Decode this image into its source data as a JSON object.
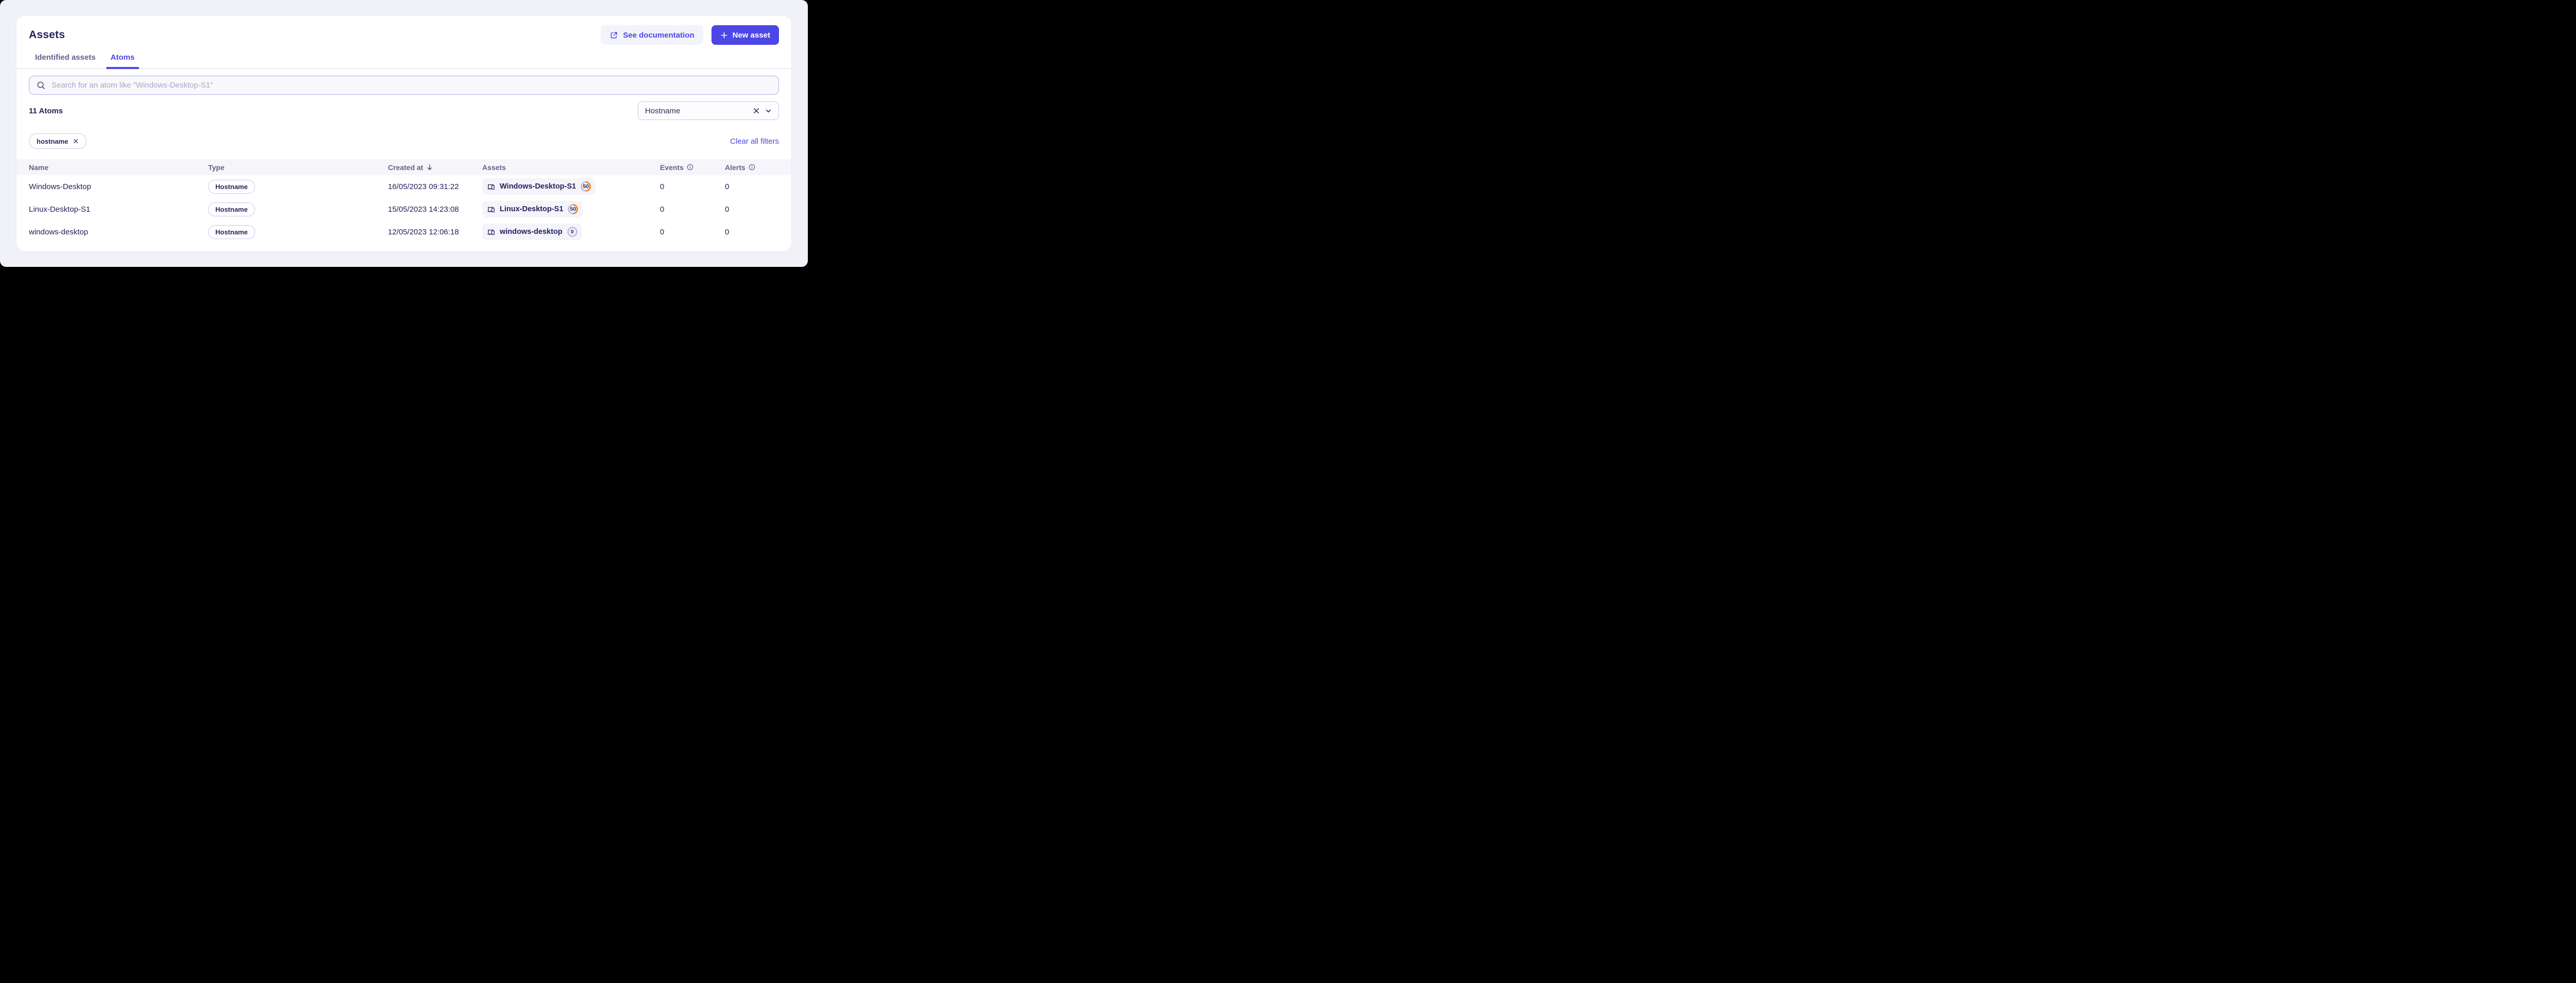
{
  "header": {
    "title": "Assets",
    "see_documentation_label": "See documentation",
    "new_asset_label": "New asset"
  },
  "tabs": [
    {
      "label": "Identified assets",
      "active": false
    },
    {
      "label": "Atoms",
      "active": true
    }
  ],
  "search": {
    "placeholder": "Search for an atom like \"Windows-Desktop-S1\""
  },
  "toolbar": {
    "count_label": "11 Atoms",
    "filter_select": {
      "value": "Hostname"
    }
  },
  "filters": {
    "chips": [
      {
        "label": "hostname"
      }
    ],
    "clear_all_label": "Clear all filters"
  },
  "table": {
    "columns": [
      {
        "label": "Name"
      },
      {
        "label": "Type"
      },
      {
        "label": "Created at",
        "sorted": "desc"
      },
      {
        "label": "Assets"
      },
      {
        "label": "Events",
        "info": true
      },
      {
        "label": "Alerts",
        "info": true
      }
    ],
    "rows": [
      {
        "name": "Windows-Desktop",
        "type": "Hostname",
        "created_at": "16/05/2023 09:31:22",
        "asset": {
          "name": "Windows-Desktop-S1",
          "score": "50",
          "score_pct": 50
        },
        "events": "0",
        "alerts": "0"
      },
      {
        "name": "Linux-Desktop-S1",
        "type": "Hostname",
        "created_at": "15/05/2023 14:23:08",
        "asset": {
          "name": "Linux-Desktop-S1",
          "score": "50",
          "score_pct": 50
        },
        "events": "0",
        "alerts": "0"
      },
      {
        "name": "windows-desktop",
        "type": "Hostname",
        "created_at": "12/05/2023 12:06:18",
        "asset": {
          "name": "windows-desktop",
          "score": "0",
          "score_pct": 0
        },
        "events": "0",
        "alerts": "0"
      }
    ]
  },
  "colors": {
    "accent_indigo": "#4c46e5",
    "title_navy": "#23235c",
    "muted": "#62628a",
    "score_orange": "#f97d0f",
    "ring_lavender": "#b9b8e8"
  }
}
